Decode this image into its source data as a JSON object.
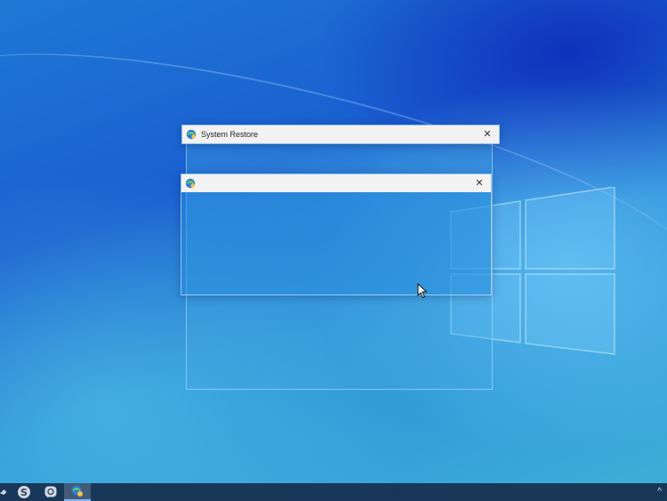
{
  "windows": {
    "main": {
      "title": "System Restore",
      "icon": "system-restore-icon",
      "close_glyph": "✕"
    },
    "secondary": {
      "title": "",
      "icon": "system-restore-icon",
      "close_glyph": "✕"
    }
  },
  "taskbar": {
    "items": [
      {
        "icon": "pinned-app-icon"
      },
      {
        "icon": "skype-icon"
      },
      {
        "icon": "viber-icon"
      },
      {
        "icon": "system-restore-icon",
        "active": true
      }
    ],
    "tray_glyph": "^"
  },
  "colors": {
    "desktop_accent": "#1a5fd0",
    "titlebar": "#f2f2f2",
    "taskbar": "#142846"
  }
}
